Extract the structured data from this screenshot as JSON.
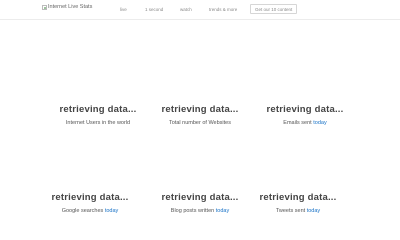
{
  "header": {
    "logo_alt": "Internet Live Stats",
    "nav": [
      "live",
      "1 second",
      "watch",
      "trends & more"
    ],
    "cta": "Get our 10 content"
  },
  "stats": [
    {
      "value": "retrieving data...",
      "label": "Internet Users in the world",
      "link": ""
    },
    {
      "value": "retrieving data...",
      "label": "Total number of Websites",
      "link": ""
    },
    {
      "value": "retrieving data...",
      "label": "Emails sent",
      "link": "today"
    },
    {
      "value": "retrieving data...",
      "label": "Google searches",
      "link": "today"
    },
    {
      "value": "retrieving data...",
      "label": "Blog posts written",
      "link": "today"
    },
    {
      "value": "retrieving data...",
      "label": "Tweets sent",
      "link": "today"
    }
  ]
}
